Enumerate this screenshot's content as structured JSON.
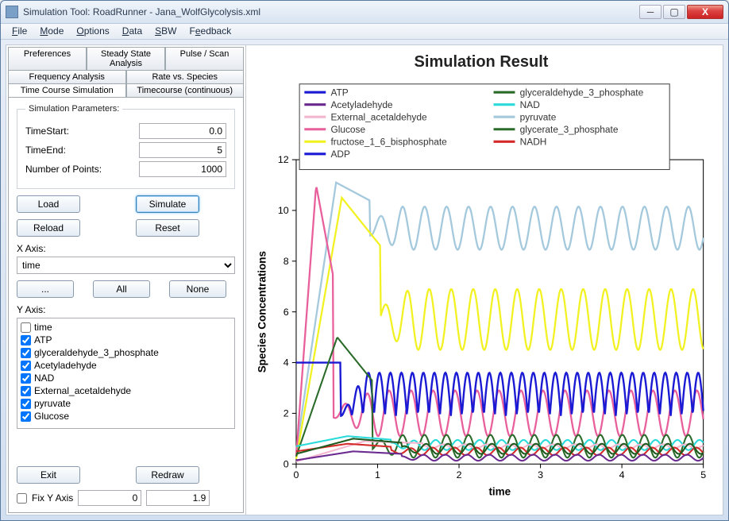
{
  "window": {
    "title": "Simulation Tool: RoadRunner - Jana_WolfGlycolysis.xml",
    "min": "—",
    "max": "☐",
    "close": "X"
  },
  "menu": [
    "File",
    "Mode",
    "Options",
    "Data",
    "SBW",
    "Feedback"
  ],
  "tabs": {
    "r1": [
      "Preferences",
      "Steady State Analysis",
      "Pulse / Scan"
    ],
    "r2": [
      "Frequency Analysis",
      "Rate vs. Species"
    ],
    "r3": [
      "Time Course Simulation",
      "Timecourse (continuous)"
    ],
    "active": "Time Course Simulation"
  },
  "params": {
    "legend": "Simulation Parameters:",
    "timeStartLabel": "TimeStart:",
    "timeStart": "0.0",
    "timeEndLabel": "TimeEnd:",
    "timeEnd": "5",
    "numPtsLabel": "Number of Points:",
    "numPts": "1000"
  },
  "buttons": {
    "load": "Load",
    "simulate": "Simulate",
    "reload": "Reload",
    "reset": "Reset",
    "dots": "...",
    "all": "All",
    "none": "None",
    "exit": "Exit",
    "redraw": "Redraw"
  },
  "xaxis": {
    "label": "X Axis:",
    "value": "time"
  },
  "yaxis": {
    "label": "Y Axis:",
    "items": [
      {
        "label": "time",
        "checked": false
      },
      {
        "label": "ATP",
        "checked": true
      },
      {
        "label": "glyceraldehyde_3_phosphate",
        "checked": true
      },
      {
        "label": "Acetyladehyde",
        "checked": true
      },
      {
        "label": "NAD",
        "checked": true
      },
      {
        "label": "External_acetaldehyde",
        "checked": true
      },
      {
        "label": "pyruvate",
        "checked": true
      },
      {
        "label": "Glucose",
        "checked": true
      }
    ]
  },
  "fix": {
    "label": "Fix Y Axis",
    "lo": "0",
    "hi": "1.9"
  },
  "chart": {
    "title": "Simulation Result",
    "xlabel": "time",
    "ylabel": "Species Concentrations"
  },
  "legend_series": [
    {
      "name": "ATP",
      "color": "#1a1ad4"
    },
    {
      "name": "Acetyladehyde",
      "color": "#6b2a8f"
    },
    {
      "name": "External_acetaldehyde",
      "color": "#f4b6cf"
    },
    {
      "name": "Glucose",
      "color": "#e85f9c"
    },
    {
      "name": "fructose_1_6_bisphosphate",
      "color": "#f2f223"
    },
    {
      "name": "ADP",
      "color": "#1a1ad4"
    },
    {
      "name": "glyceraldehyde_3_phosphate",
      "color": "#2a6b2a"
    },
    {
      "name": "NAD",
      "color": "#2adada"
    },
    {
      "name": "pyruvate",
      "color": "#a4c9dd"
    },
    {
      "name": "glycerate_3_phosphate",
      "color": "#2a6b2a"
    },
    {
      "name": "NADH",
      "color": "#d42a2a"
    }
  ],
  "chart_data": {
    "type": "line",
    "xlabel": "time",
    "ylabel": "Species Concentrations",
    "xlim": [
      0,
      5
    ],
    "ylim": [
      0,
      12
    ],
    "xticks": [
      0,
      1,
      2,
      3,
      4,
      5
    ],
    "yticks": [
      0,
      2,
      4,
      6,
      8,
      10,
      12
    ],
    "note": "Values below are visual estimates read from the plot. Most series exhibit damped then sustained oscillations with period ≈0.25 after t≈1.",
    "series": [
      {
        "name": "ATP",
        "color": "#1a1ad4",
        "approx": "starts ~4, drops sharply near t≈0.6, then oscillates 0.3–3.6 with period ~0.25"
      },
      {
        "name": "Acetyladehyde",
        "color": "#6b2a8f",
        "approx": "low, oscillates ~0.1–0.4"
      },
      {
        "name": "External_acetaldehyde",
        "color": "#f4b6cf",
        "approx": "rises to ~0.7 then small oscillations ~0.6–0.8"
      },
      {
        "name": "Glucose",
        "color": "#e85f9c",
        "approx": "peaks at ~11 near t≈0.35, decays with oscillations to ~1–3"
      },
      {
        "name": "fructose_1_6_bisphosphate",
        "color": "#f2f223",
        "approx": "rises to ~10.5 at t≈0.7, settles to oscillations ~4.5–7"
      },
      {
        "name": "ADP",
        "color": "#1a1ad4",
        "approx": "complement of ATP, oscillates ~0.3–3.6"
      },
      {
        "name": "glyceraldehyde_3_phosphate",
        "color": "#2a6b2a",
        "approx": "spike to ~5 near t≈0.7, then oscillates ~0.3–1.2"
      },
      {
        "name": "NAD",
        "color": "#2adada",
        "approx": "oscillates ~0.5–1.0"
      },
      {
        "name": "pyruvate",
        "color": "#a4c9dd",
        "approx": "rises to ~11 near t≈0.7, sustained oscillations ~8.5–10.2"
      },
      {
        "name": "glycerate_3_phosphate",
        "color": "#2a6b2a",
        "approx": "oscillates ~0.3–0.9"
      },
      {
        "name": "NADH",
        "color": "#d42a2a",
        "approx": "oscillates ~0.3–0.7"
      }
    ]
  }
}
